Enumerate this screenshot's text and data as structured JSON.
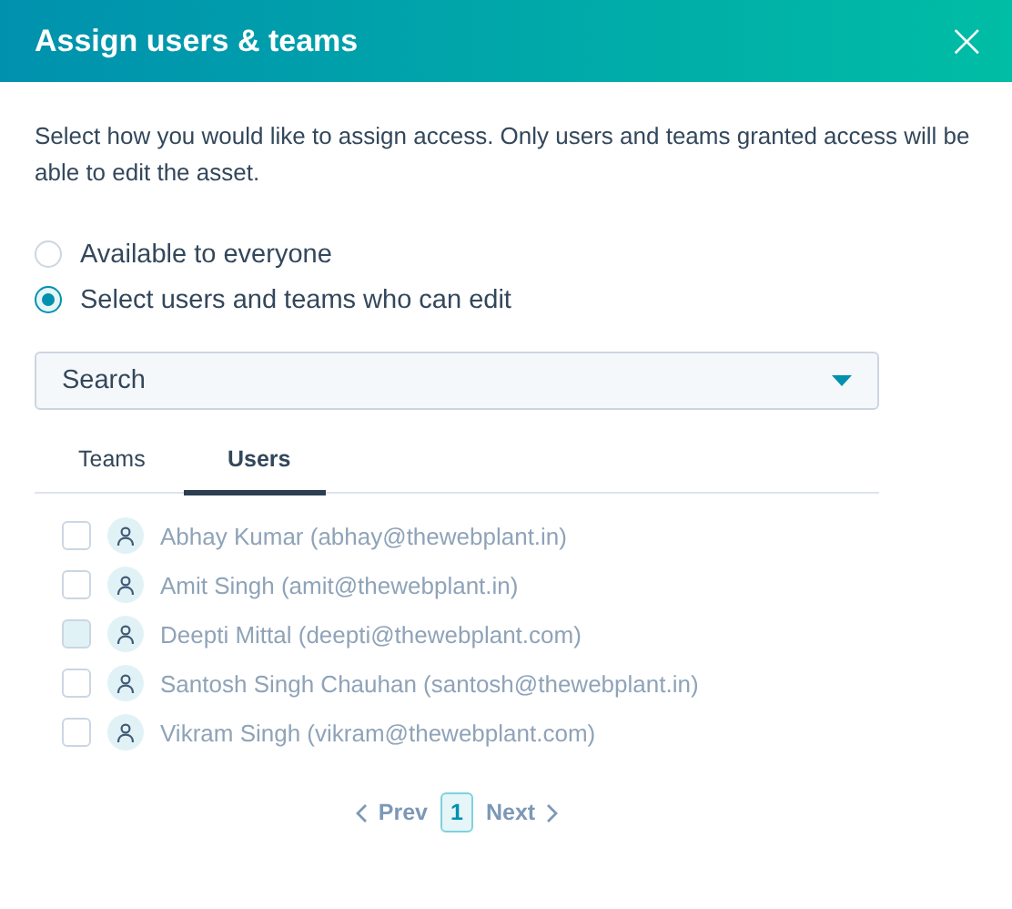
{
  "dialog": {
    "title": "Assign users & teams",
    "close": "×"
  },
  "description": "Select how you would like to assign access. Only users and teams granted access will be able to edit the asset.",
  "options": [
    {
      "label": "Available to everyone",
      "selected": false
    },
    {
      "label": "Select users and teams who can edit",
      "selected": true
    }
  ],
  "search": {
    "placeholder": "Search"
  },
  "tabs": [
    {
      "label": "Teams",
      "selected": false
    },
    {
      "label": "Users",
      "selected": true
    }
  ],
  "users": [
    {
      "name": "Abhay Kumar (abhay@thewebplant.in)",
      "checked": false,
      "highlighted": false,
      "disabled": true
    },
    {
      "name": "Amit Singh (amit@thewebplant.in)",
      "checked": false,
      "highlighted": false,
      "disabled": true
    },
    {
      "name": "Deepti Mittal (deepti@thewebplant.com)",
      "checked": false,
      "highlighted": true,
      "disabled": true
    },
    {
      "name": "Santosh Singh Chauhan (santosh@thewebplant.in)",
      "checked": false,
      "highlighted": false,
      "disabled": true
    },
    {
      "name": "Vikram Singh (vikram@thewebplant.com)",
      "checked": false,
      "highlighted": false,
      "disabled": true
    }
  ],
  "pagination": {
    "prev": "Prev",
    "pages": [
      {
        "label": "1",
        "selected": true
      }
    ],
    "next": "Next"
  }
}
